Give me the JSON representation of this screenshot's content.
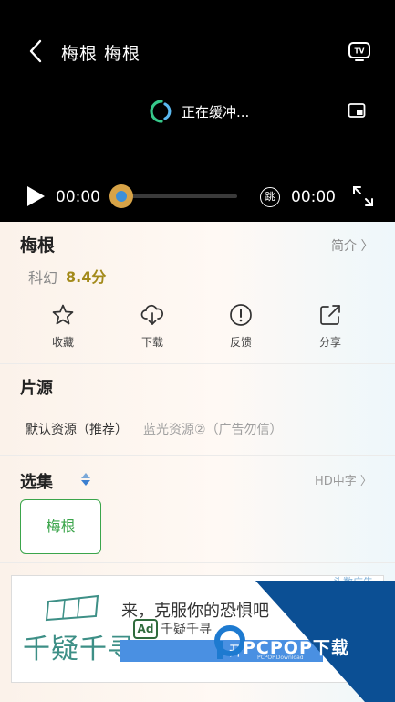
{
  "player": {
    "title": "梅根   梅根",
    "loading_text": "正在缓冲...",
    "current_time": "00:00",
    "total_time": "00:00",
    "skip_label": "跳",
    "progress": 0
  },
  "movie": {
    "title": "梅根",
    "intro_label": "简介 〉",
    "genre": "科幻",
    "score": "8.4分"
  },
  "actions": [
    {
      "label": "收藏",
      "icon": "star-icon"
    },
    {
      "label": "下载",
      "icon": "cloud-download-icon"
    },
    {
      "label": "反馈",
      "icon": "alert-circle-icon"
    },
    {
      "label": "分享",
      "icon": "share-icon"
    }
  ],
  "sources": {
    "title": "片源",
    "items": [
      "默认资源（推荐）",
      "蓝光资源②（广告勿信）"
    ]
  },
  "episodes": {
    "title": "选集",
    "quality_label": "HD中字 〉",
    "items": [
      "梅根"
    ]
  },
  "ad": {
    "logo_text": "千疑千寻",
    "headline": "来，克服你的恐惧吧",
    "badge": "Ad",
    "brand": "千疑千寻",
    "button_label": "开",
    "corner_label": "头数广告"
  },
  "watermark": {
    "text": "PCPOP下载",
    "sub": "PCPOP.Download"
  },
  "colors": {
    "accent_green": "#3ba54b",
    "score_gold": "#a38a1a",
    "player_bg": "#000000",
    "progress_thumb": "#d7a347",
    "watermark_blue": "#0b4f94"
  }
}
